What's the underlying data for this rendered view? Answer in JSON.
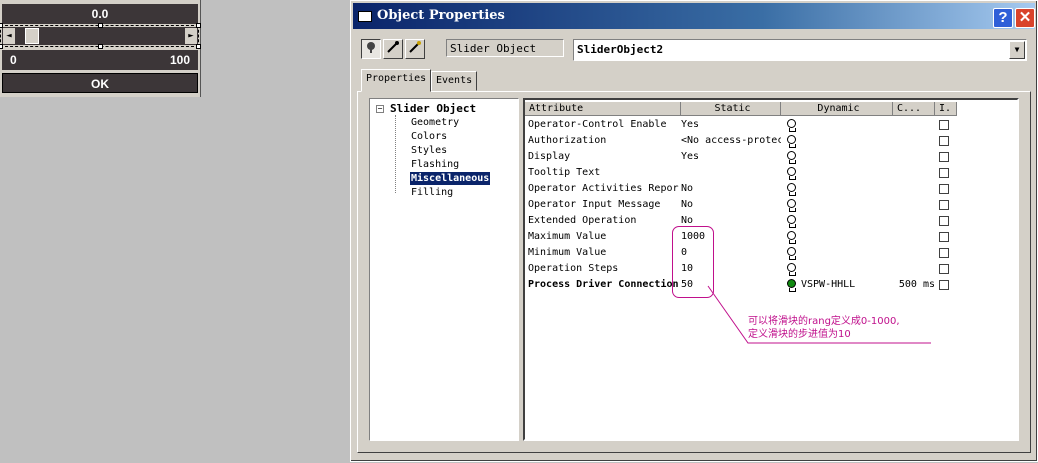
{
  "slider_widget": {
    "value": "0.0",
    "min_label": "0",
    "max_label": "100",
    "ok_label": "OK",
    "left_arrow": "◄",
    "right_arrow": "►"
  },
  "dialog": {
    "title": "Object Properties",
    "help_glyph": "?",
    "close_glyph": "✕",
    "object_type": "Slider Object",
    "object_name": "SliderObject2",
    "dropdown_glyph": "▼",
    "tools": [
      "pin-icon",
      "pipette-icon",
      "pipette-edit-icon"
    ],
    "tabs": [
      "Properties",
      "Events"
    ]
  },
  "tree": {
    "root": "Slider Object",
    "toggle": "−",
    "items": [
      "Geometry",
      "Colors",
      "Styles",
      "Flashing",
      "Miscellaneous",
      "Filling"
    ],
    "selected": "Miscellaneous"
  },
  "grid": {
    "headers": [
      "Attribute",
      "Static",
      "Dynamic",
      "C...",
      "I."
    ],
    "rows": [
      {
        "attr": "Operator-Control Enable",
        "static": "Yes",
        "dynamic": "",
        "cycle": ""
      },
      {
        "attr": "Authorization",
        "static": "<No access-protect",
        "dynamic": "",
        "cycle": ""
      },
      {
        "attr": "Display",
        "static": "Yes",
        "dynamic": "",
        "cycle": ""
      },
      {
        "attr": "Tooltip Text",
        "static": "",
        "dynamic": "",
        "cycle": ""
      },
      {
        "attr": "Operator Activities Report",
        "static": "No",
        "dynamic": "",
        "cycle": ""
      },
      {
        "attr": "Operator Input Message",
        "static": "No",
        "dynamic": "",
        "cycle": ""
      },
      {
        "attr": "Extended Operation",
        "static": "No",
        "dynamic": "",
        "cycle": ""
      },
      {
        "attr": "Maximum Value",
        "static": "1000",
        "dynamic": "",
        "cycle": ""
      },
      {
        "attr": "Minimum Value",
        "static": "0",
        "dynamic": "",
        "cycle": ""
      },
      {
        "attr": "Operation Steps",
        "static": "10",
        "dynamic": "",
        "cycle": ""
      },
      {
        "attr": "Process Driver Connection",
        "static": "50",
        "dynamic": "VSPW-HHLL",
        "cycle": "500 ms"
      }
    ]
  },
  "annotation": {
    "line1": "可以将滑块的rang定义成0-1000,",
    "line2": "定义滑块的步进值为10",
    "color": "#c0108c"
  }
}
